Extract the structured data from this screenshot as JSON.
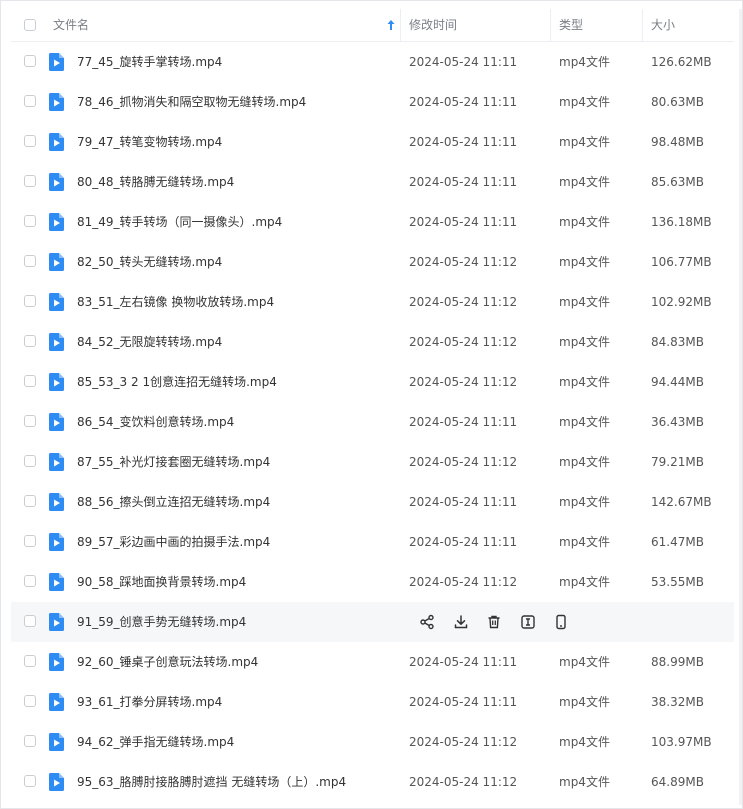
{
  "header": {
    "name_label": "文件名",
    "time_label": "修改时间",
    "type_label": "类型",
    "size_label": "大小"
  },
  "colors": {
    "file_icon": "#2f8cf2",
    "sort_arrow": "#2f8cf2",
    "hover_row": "#f6f7f9"
  },
  "hover_actions": [
    "share-icon",
    "download-icon",
    "delete-icon",
    "rename-icon",
    "mobile-icon"
  ],
  "files": [
    {
      "name": "77_45_旋转手掌转场.mp4",
      "time": "2024-05-24 11:11",
      "type": "mp4文件",
      "size": "126.62MB"
    },
    {
      "name": "78_46_抓物消失和隔空取物无缝转场.mp4",
      "time": "2024-05-24 11:11",
      "type": "mp4文件",
      "size": "80.63MB"
    },
    {
      "name": "79_47_转笔变物转场.mp4",
      "time": "2024-05-24 11:11",
      "type": "mp4文件",
      "size": "98.48MB"
    },
    {
      "name": "80_48_转胳膊无缝转场.mp4",
      "time": "2024-05-24 11:11",
      "type": "mp4文件",
      "size": "85.63MB"
    },
    {
      "name": "81_49_转手转场（同一摄像头）.mp4",
      "time": "2024-05-24 11:11",
      "type": "mp4文件",
      "size": "136.18MB"
    },
    {
      "name": "82_50_转头无缝转场.mp4",
      "time": "2024-05-24 11:12",
      "type": "mp4文件",
      "size": "106.77MB"
    },
    {
      "name": "83_51_左右镜像 换物收放转场.mp4",
      "time": "2024-05-24 11:12",
      "type": "mp4文件",
      "size": "102.92MB"
    },
    {
      "name": "84_52_无限旋转转场.mp4",
      "time": "2024-05-24 11:12",
      "type": "mp4文件",
      "size": "84.83MB"
    },
    {
      "name": "85_53_3 2 1创意连招无缝转场.mp4",
      "time": "2024-05-24 11:12",
      "type": "mp4文件",
      "size": "94.44MB"
    },
    {
      "name": "86_54_变饮料创意转场.mp4",
      "time": "2024-05-24 11:11",
      "type": "mp4文件",
      "size": "36.43MB"
    },
    {
      "name": "87_55_补光灯接套圈无缝转场.mp4",
      "time": "2024-05-24 11:12",
      "type": "mp4文件",
      "size": "79.21MB"
    },
    {
      "name": "88_56_擦头倒立连招无缝转场.mp4",
      "time": "2024-05-24 11:11",
      "type": "mp4文件",
      "size": "142.67MB"
    },
    {
      "name": "89_57_彩边画中画的拍摄手法.mp4",
      "time": "2024-05-24 11:11",
      "type": "mp4文件",
      "size": "61.47MB"
    },
    {
      "name": "90_58_踩地面换背景转场.mp4",
      "time": "2024-05-24 11:12",
      "type": "mp4文件",
      "size": "53.55MB"
    },
    {
      "name": "91_59_创意手势无缝转场.mp4",
      "time": "",
      "type": "",
      "size": "",
      "hover": true
    },
    {
      "name": "92_60_锤桌子创意玩法转场.mp4",
      "time": "2024-05-24 11:11",
      "type": "mp4文件",
      "size": "88.99MB"
    },
    {
      "name": "93_61_打拳分屏转场.mp4",
      "time": "2024-05-24 11:11",
      "type": "mp4文件",
      "size": "38.32MB"
    },
    {
      "name": "94_62_弹手指无缝转场.mp4",
      "time": "2024-05-24 11:12",
      "type": "mp4文件",
      "size": "103.97MB"
    },
    {
      "name": "95_63_胳膊肘接胳膊肘遮挡 无缝转场（上）.mp4",
      "time": "2024-05-24 11:12",
      "type": "mp4文件",
      "size": "64.89MB"
    }
  ]
}
